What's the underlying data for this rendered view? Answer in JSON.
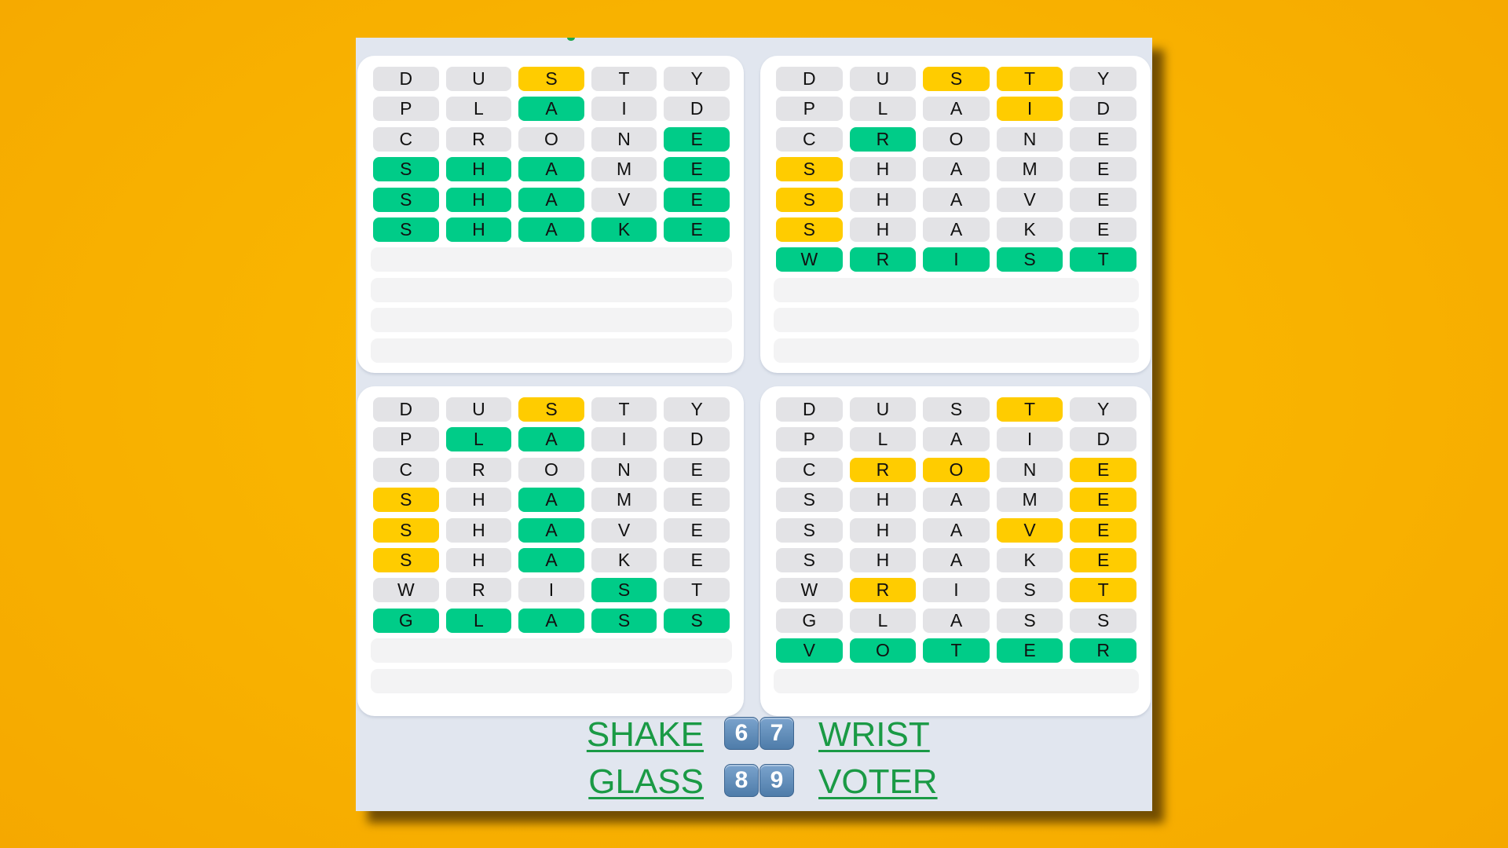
{
  "game": "Quordle",
  "colors": {
    "correct": "#00cc88",
    "present": "#ffcc00",
    "absent": "#e3e3e6",
    "answer_link": "#1a9a45",
    "background": "#f9b400"
  },
  "guesses": [
    "DUSTY",
    "PLAID",
    "CRONE",
    "SHAME",
    "SHAVE",
    "SHAKE",
    "WRIST",
    "GLASS",
    "VOTER"
  ],
  "boards": [
    {
      "id": "top-left",
      "answer": "SHAKE",
      "rows": [
        {
          "letters": [
            "D",
            "U",
            "S",
            "T",
            "Y"
          ],
          "states": [
            "absent",
            "absent",
            "present",
            "absent",
            "absent"
          ]
        },
        {
          "letters": [
            "P",
            "L",
            "A",
            "I",
            "D"
          ],
          "states": [
            "absent",
            "absent",
            "correct",
            "absent",
            "absent"
          ]
        },
        {
          "letters": [
            "C",
            "R",
            "O",
            "N",
            "E"
          ],
          "states": [
            "absent",
            "absent",
            "absent",
            "absent",
            "correct"
          ]
        },
        {
          "letters": [
            "S",
            "H",
            "A",
            "M",
            "E"
          ],
          "states": [
            "correct",
            "correct",
            "correct",
            "absent",
            "correct"
          ]
        },
        {
          "letters": [
            "S",
            "H",
            "A",
            "V",
            "E"
          ],
          "states": [
            "correct",
            "correct",
            "correct",
            "absent",
            "correct"
          ]
        },
        {
          "letters": [
            "S",
            "H",
            "A",
            "K",
            "E"
          ],
          "states": [
            "correct",
            "correct",
            "correct",
            "correct",
            "correct"
          ]
        }
      ],
      "empty_rows": 4
    },
    {
      "id": "top-right",
      "answer": "WRIST",
      "rows": [
        {
          "letters": [
            "D",
            "U",
            "S",
            "T",
            "Y"
          ],
          "states": [
            "absent",
            "absent",
            "present",
            "present",
            "absent"
          ]
        },
        {
          "letters": [
            "P",
            "L",
            "A",
            "I",
            "D"
          ],
          "states": [
            "absent",
            "absent",
            "absent",
            "present",
            "absent"
          ]
        },
        {
          "letters": [
            "C",
            "R",
            "O",
            "N",
            "E"
          ],
          "states": [
            "absent",
            "correct",
            "absent",
            "absent",
            "absent"
          ]
        },
        {
          "letters": [
            "S",
            "H",
            "A",
            "M",
            "E"
          ],
          "states": [
            "present",
            "absent",
            "absent",
            "absent",
            "absent"
          ]
        },
        {
          "letters": [
            "S",
            "H",
            "A",
            "V",
            "E"
          ],
          "states": [
            "present",
            "absent",
            "absent",
            "absent",
            "absent"
          ]
        },
        {
          "letters": [
            "S",
            "H",
            "A",
            "K",
            "E"
          ],
          "states": [
            "present",
            "absent",
            "absent",
            "absent",
            "absent"
          ]
        },
        {
          "letters": [
            "W",
            "R",
            "I",
            "S",
            "T"
          ],
          "states": [
            "correct",
            "correct",
            "correct",
            "correct",
            "correct"
          ]
        }
      ],
      "empty_rows": 3
    },
    {
      "id": "bottom-left",
      "answer": "GLASS",
      "rows": [
        {
          "letters": [
            "D",
            "U",
            "S",
            "T",
            "Y"
          ],
          "states": [
            "absent",
            "absent",
            "present",
            "absent",
            "absent"
          ]
        },
        {
          "letters": [
            "P",
            "L",
            "A",
            "I",
            "D"
          ],
          "states": [
            "absent",
            "correct",
            "correct",
            "absent",
            "absent"
          ]
        },
        {
          "letters": [
            "C",
            "R",
            "O",
            "N",
            "E"
          ],
          "states": [
            "absent",
            "absent",
            "absent",
            "absent",
            "absent"
          ]
        },
        {
          "letters": [
            "S",
            "H",
            "A",
            "M",
            "E"
          ],
          "states": [
            "present",
            "absent",
            "correct",
            "absent",
            "absent"
          ]
        },
        {
          "letters": [
            "S",
            "H",
            "A",
            "V",
            "E"
          ],
          "states": [
            "present",
            "absent",
            "correct",
            "absent",
            "absent"
          ]
        },
        {
          "letters": [
            "S",
            "H",
            "A",
            "K",
            "E"
          ],
          "states": [
            "present",
            "absent",
            "correct",
            "absent",
            "absent"
          ]
        },
        {
          "letters": [
            "W",
            "R",
            "I",
            "S",
            "T"
          ],
          "states": [
            "absent",
            "absent",
            "absent",
            "correct",
            "absent"
          ]
        },
        {
          "letters": [
            "G",
            "L",
            "A",
            "S",
            "S"
          ],
          "states": [
            "correct",
            "correct",
            "correct",
            "correct",
            "correct"
          ]
        }
      ],
      "empty_rows": 2
    },
    {
      "id": "bottom-right",
      "answer": "VOTER",
      "rows": [
        {
          "letters": [
            "D",
            "U",
            "S",
            "T",
            "Y"
          ],
          "states": [
            "absent",
            "absent",
            "absent",
            "present",
            "absent"
          ]
        },
        {
          "letters": [
            "P",
            "L",
            "A",
            "I",
            "D"
          ],
          "states": [
            "absent",
            "absent",
            "absent",
            "absent",
            "absent"
          ]
        },
        {
          "letters": [
            "C",
            "R",
            "O",
            "N",
            "E"
          ],
          "states": [
            "absent",
            "present",
            "present",
            "absent",
            "present"
          ]
        },
        {
          "letters": [
            "S",
            "H",
            "A",
            "M",
            "E"
          ],
          "states": [
            "absent",
            "absent",
            "absent",
            "absent",
            "present"
          ]
        },
        {
          "letters": [
            "S",
            "H",
            "A",
            "V",
            "E"
          ],
          "states": [
            "absent",
            "absent",
            "absent",
            "present",
            "present"
          ]
        },
        {
          "letters": [
            "S",
            "H",
            "A",
            "K",
            "E"
          ],
          "states": [
            "absent",
            "absent",
            "absent",
            "absent",
            "present"
          ]
        },
        {
          "letters": [
            "W",
            "R",
            "I",
            "S",
            "T"
          ],
          "states": [
            "absent",
            "present",
            "absent",
            "absent",
            "present"
          ]
        },
        {
          "letters": [
            "G",
            "L",
            "A",
            "S",
            "S"
          ],
          "states": [
            "absent",
            "absent",
            "absent",
            "absent",
            "absent"
          ]
        },
        {
          "letters": [
            "V",
            "O",
            "T",
            "E",
            "R"
          ],
          "states": [
            "correct",
            "correct",
            "correct",
            "correct",
            "correct"
          ]
        }
      ],
      "empty_rows": 1
    }
  ],
  "results": {
    "row1": {
      "left_word": "SHAKE",
      "scores": [
        "6",
        "7"
      ],
      "right_word": "WRIST"
    },
    "row2": {
      "left_word": "GLASS",
      "scores": [
        "8",
        "9"
      ],
      "right_word": "VOTER"
    }
  }
}
